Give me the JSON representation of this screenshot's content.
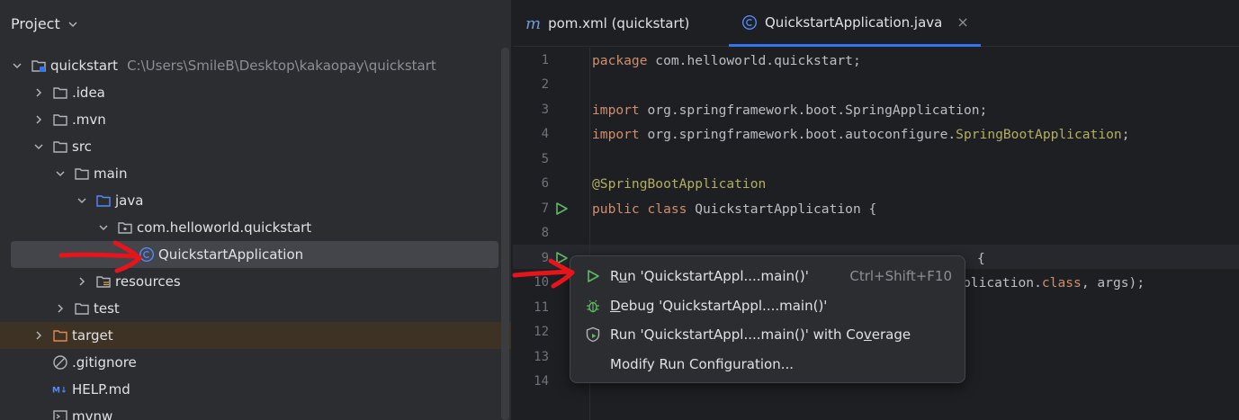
{
  "project": {
    "title": "Project",
    "tree": [
      {
        "label": "quickstart",
        "path": "C:\\Users\\SmileB\\Desktop\\kakaopay\\quickstart"
      },
      {
        "label": ".idea"
      },
      {
        "label": ".mvn"
      },
      {
        "label": "src"
      },
      {
        "label": "main"
      },
      {
        "label": "java"
      },
      {
        "label": "com.helloworld.quickstart"
      },
      {
        "label": "QuickstartApplication"
      },
      {
        "label": "resources"
      },
      {
        "label": "test"
      },
      {
        "label": "target"
      },
      {
        "label": ".gitignore"
      },
      {
        "label": "HELP.md"
      },
      {
        "label": "mvnw"
      }
    ]
  },
  "editor": {
    "tabs": [
      {
        "icon": "m",
        "label": "pom.xml (quickstart)"
      },
      {
        "label": "QuickstartApplication.java",
        "close": "×"
      }
    ],
    "line_numbers": [
      "1",
      "2",
      "3",
      "4",
      "5",
      "6",
      "7",
      "8",
      "9",
      "10",
      "11",
      "12",
      "13",
      "14"
    ],
    "code": {
      "l1_kw": "package",
      "l1_rest": " com.helloworld.quickstart;",
      "l3_kw": "import",
      "l3_rest": " org.springframework.boot.SpringApplication;",
      "l4_kw": "import",
      "l4_rest": " org.springframework.boot.autoconfigure.",
      "l4_type": "SpringBootApplication",
      "l4_end": ";",
      "l6_ann": "@SpringBootApplication",
      "l7_kw": "public class",
      "l7_rest": " QuickstartApplication {",
      "l9_visible": "{",
      "l10_visible": "plication.",
      "l10_kw": "class",
      "l10_end": ", args);"
    }
  },
  "run_menu": {
    "items": [
      {
        "pre": "R",
        "ul": "u",
        "post": "n 'QuickstartAppl....main()'",
        "shortcut": "Ctrl+Shift+F10"
      },
      {
        "pre": "",
        "ul": "D",
        "post": "ebug 'QuickstartAppl....main()'"
      },
      {
        "pre": "Run 'QuickstartAppl....main()' with Co",
        "ul": "v",
        "post": "erage"
      },
      {
        "pre": "Modify Run Configuration...",
        "ul": "",
        "post": ""
      }
    ]
  },
  "colors": {
    "accent": "#3574f0",
    "run_green": "#5fb865",
    "annotation_red": "#e8141c"
  }
}
